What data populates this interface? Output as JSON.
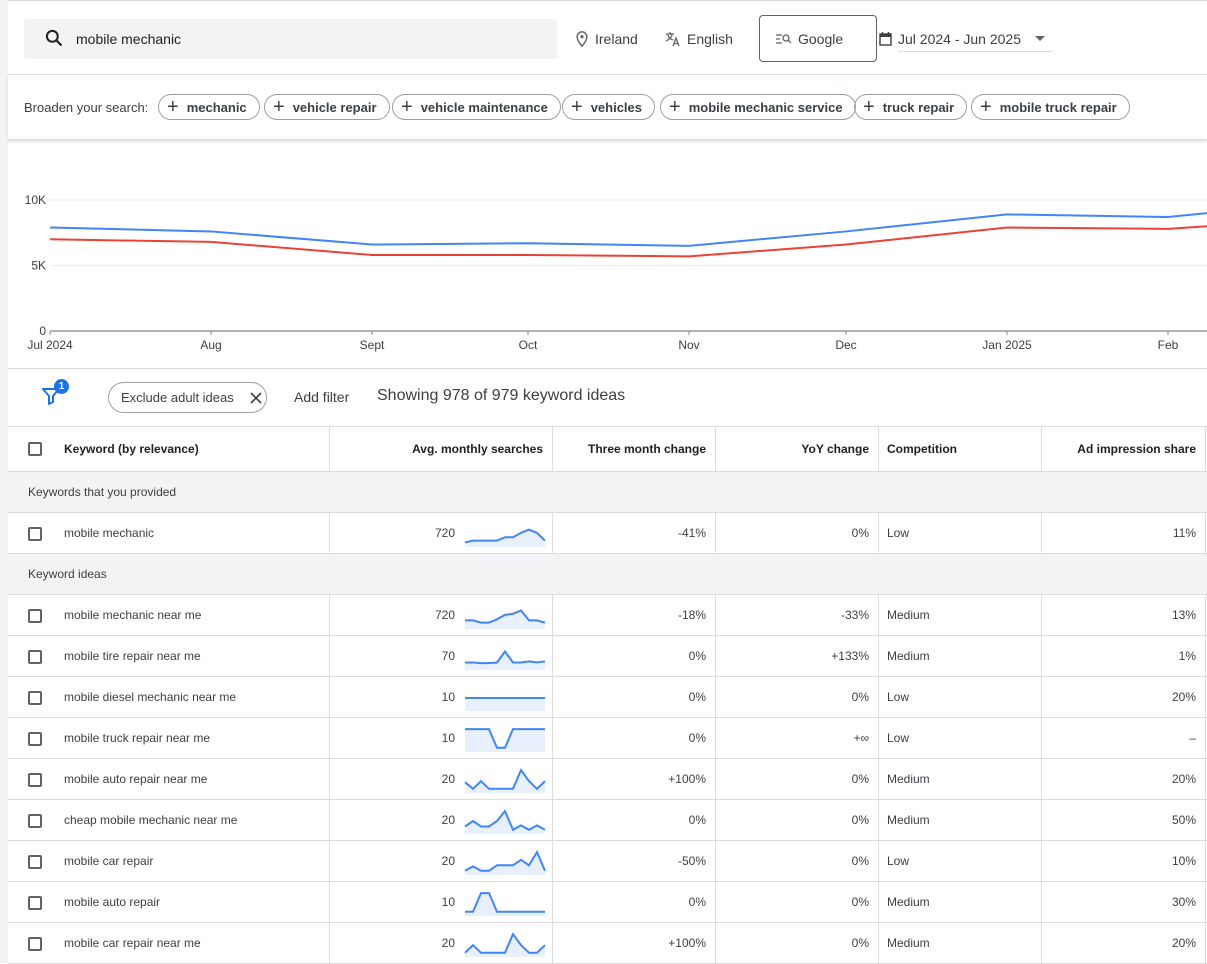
{
  "search": {
    "query": "mobile mechanic",
    "location": "Ireland",
    "language": "English",
    "engine": "Google",
    "date_range": "Jul 2024 - Jun 2025"
  },
  "broaden": {
    "label": "Broaden your search:",
    "chips": [
      "mechanic",
      "vehicle repair",
      "vehicle maintenance",
      "vehicles",
      "mobile mechanic service",
      "truck repair",
      "mobile truck repair"
    ]
  },
  "chart_data": {
    "type": "line",
    "x": [
      "Jul 2024",
      "Aug",
      "Sept",
      "Oct",
      "Nov",
      "Dec",
      "Jan 2025",
      "Feb"
    ],
    "y_ticks": [
      "0",
      "5K",
      "10K"
    ],
    "ylim": [
      0,
      10000
    ],
    "series": [
      {
        "color": "#4285f4",
        "values": [
          7900,
          7600,
          6600,
          6700,
          6500,
          7600,
          8900,
          8700,
          9000
        ]
      },
      {
        "color": "#ea4335",
        "values": [
          7000,
          6800,
          5800,
          5800,
          5700,
          6600,
          7900,
          7800,
          8000
        ]
      }
    ]
  },
  "filters": {
    "badge": "1",
    "exclude_chip": "Exclude adult ideas",
    "add_filter": "Add filter",
    "showing": "Showing 978 of 979 keyword ideas"
  },
  "table": {
    "headers": [
      "Keyword (by relevance)",
      "Avg. monthly searches",
      "Three month change",
      "YoY change",
      "Competition",
      "Ad impression share"
    ],
    "group_provided": "Keywords that you provided",
    "provided": [
      {
        "keyword": "mobile mechanic",
        "searches": "720",
        "three_month": "-41%",
        "yoy": "0%",
        "competition": "Low",
        "share": "11%",
        "trend": [
          0.12,
          0.2,
          0.2,
          0.2,
          0.2,
          0.35,
          0.35,
          0.55,
          0.7,
          0.55,
          0.2
        ]
      }
    ],
    "group_ideas": "Keyword ideas",
    "ideas": [
      {
        "keyword": "mobile mechanic near me",
        "searches": "720",
        "three_month": "-18%",
        "yoy": "-33%",
        "competition": "Medium",
        "share": "13%",
        "trend": [
          0.3,
          0.3,
          0.2,
          0.2,
          0.35,
          0.55,
          0.6,
          0.75,
          0.3,
          0.3,
          0.2
        ]
      },
      {
        "keyword": "mobile tire repair near me",
        "searches": "70",
        "three_month": "0%",
        "yoy": "+133%",
        "competition": "Medium",
        "share": "1%",
        "trend": [
          0.25,
          0.25,
          0.22,
          0.22,
          0.25,
          0.75,
          0.25,
          0.25,
          0.3,
          0.25,
          0.3
        ]
      },
      {
        "keyword": "mobile diesel mechanic near me",
        "searches": "10",
        "three_month": "0%",
        "yoy": "0%",
        "competition": "Low",
        "share": "20%",
        "trend": [
          0.5,
          0.5,
          0.5,
          0.5,
          0.5,
          0.5,
          0.5,
          0.5,
          0.5,
          0.5,
          0.5
        ]
      },
      {
        "keyword": "mobile truck repair near me",
        "searches": "10",
        "three_month": "0%",
        "yoy": "+∞",
        "competition": "Low",
        "share": "–",
        "trend": [
          0.95,
          0.95,
          0.95,
          0.95,
          0.1,
          0.1,
          0.95,
          0.95,
          0.95,
          0.95,
          0.95
        ]
      },
      {
        "keyword": "mobile auto repair near me",
        "searches": "20",
        "three_month": "+100%",
        "yoy": "0%",
        "competition": "Medium",
        "share": "20%",
        "trend": [
          0.4,
          0.1,
          0.45,
          0.1,
          0.1,
          0.1,
          0.1,
          0.95,
          0.45,
          0.1,
          0.45
        ]
      },
      {
        "keyword": "cheap mobile mechanic near me",
        "searches": "20",
        "three_month": "0%",
        "yoy": "0%",
        "competition": "Medium",
        "share": "50%",
        "trend": [
          0.25,
          0.5,
          0.25,
          0.25,
          0.5,
          0.95,
          0.1,
          0.3,
          0.1,
          0.3,
          0.1
        ]
      },
      {
        "keyword": "mobile car repair",
        "searches": "20",
        "three_month": "-50%",
        "yoy": "0%",
        "competition": "Low",
        "share": "10%",
        "trend": [
          0.1,
          0.3,
          0.1,
          0.1,
          0.35,
          0.35,
          0.35,
          0.6,
          0.35,
          0.95,
          0.1
        ]
      },
      {
        "keyword": "mobile auto repair",
        "searches": "10",
        "three_month": "0%",
        "yoy": "0%",
        "competition": "Medium",
        "share": "30%",
        "trend": [
          0.1,
          0.1,
          0.95,
          0.95,
          0.1,
          0.1,
          0.1,
          0.1,
          0.1,
          0.1,
          0.1
        ]
      },
      {
        "keyword": "mobile car repair near me",
        "searches": "20",
        "three_month": "+100%",
        "yoy": "0%",
        "competition": "Medium",
        "share": "20%",
        "trend": [
          0.1,
          0.45,
          0.1,
          0.1,
          0.1,
          0.1,
          0.95,
          0.45,
          0.1,
          0.1,
          0.45
        ]
      }
    ]
  }
}
